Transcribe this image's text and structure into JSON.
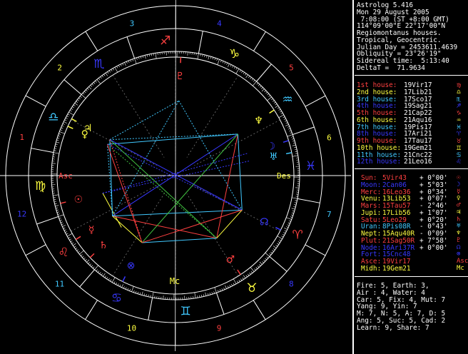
{
  "header": [
    "Astrolog 5.416",
    "Mon 29 August 2005",
    " 7:08:00 (ST +8:00 GMT)",
    "114°09'00\"E 22°17'00\"N",
    "Regiomontanus houses.",
    "Tropical, Geocentric.",
    "Julian Day = 2453611.4639",
    "Obliquity = 23°26'19\"",
    "Sidereal time:  5:13:40",
    "DeltaT =  71.9634"
  ],
  "houses": [
    {
      "label": "1st house:",
      "value": "19Vir17",
      "glyph": "♍",
      "color": "#ff4040"
    },
    {
      "label": "2nd house:",
      "value": "17Lib21",
      "glyph": "♎",
      "color": "#ffff40"
    },
    {
      "label": "3rd house:",
      "value": "17Sco17",
      "glyph": "♏",
      "color": "#40c8ff"
    },
    {
      "label": "4th house:",
      "value": "19Sag21",
      "glyph": "♐",
      "color": "#3838ff"
    },
    {
      "label": "5th house:",
      "value": "21Cap22",
      "glyph": "♑",
      "color": "#ff4040"
    },
    {
      "label": "6th house:",
      "value": "21Aqu16",
      "glyph": "♒",
      "color": "#ffff40"
    },
    {
      "label": "7th house:",
      "value": "19Pis17",
      "glyph": "♓",
      "color": "#40c8ff"
    },
    {
      "label": "8th house:",
      "value": "17Ari21",
      "glyph": "♈",
      "color": "#3838ff"
    },
    {
      "label": "9th house:",
      "value": "17Tau17",
      "glyph": "♉",
      "color": "#ff4040"
    },
    {
      "label": "10th house:",
      "value": "19Gem21",
      "glyph": "♊",
      "color": "#ffff40"
    },
    {
      "label": "11th house:",
      "value": "21Cnc22",
      "glyph": "♋",
      "color": "#40c8ff"
    },
    {
      "label": "12th house:",
      "value": "21Leo16",
      "glyph": "♌",
      "color": "#3838ff"
    }
  ],
  "planets": [
    {
      "name": "Sun:",
      "pos": "5Vir43",
      "speed": "+ 0°00'",
      "glyph": "☉",
      "color": "#ff4040"
    },
    {
      "name": "Moon:",
      "pos": "2Can06",
      "speed": "+ 5°03'",
      "glyph": "☽",
      "color": "#3838ff"
    },
    {
      "name": "Merc:",
      "pos": "16Leo36",
      "speed": "+ 0°34'",
      "glyph": "☿",
      "color": "#ff4040"
    },
    {
      "name": "Venu:",
      "pos": "13Lib53",
      "speed": "+ 0°07'",
      "glyph": "♀",
      "color": "#ffff40"
    },
    {
      "name": "Mars:",
      "pos": "15Tau57",
      "speed": "- 2°46'",
      "glyph": "♂",
      "color": "#ff4040"
    },
    {
      "name": "Jupi:",
      "pos": "17Lib56",
      "speed": "+ 1°07'",
      "glyph": "♃",
      "color": "#ffff40"
    },
    {
      "name": "Satu:",
      "pos": "5Leo29",
      "speed": "+ 0°20'",
      "glyph": "♄",
      "color": "#ff4040"
    },
    {
      "name": "Uran:",
      "pos": "8Pis08R",
      "speed": "- 0°43'",
      "glyph": "♅",
      "color": "#40c8ff"
    },
    {
      "name": "Nept:",
      "pos": "15Aqu40R",
      "speed": "- 0°09'",
      "glyph": "♆",
      "color": "#ffff40"
    },
    {
      "name": "Plut:",
      "pos": "21Sag50R",
      "speed": "+ 7°58'",
      "glyph": "♇",
      "color": "#ff4040"
    },
    {
      "name": "Node:",
      "pos": "16Ari37R",
      "speed": "+ 0°00'",
      "glyph": "☊",
      "color": "#3838ff"
    },
    {
      "name": "Fort:",
      "pos": "15Cnc48",
      "speed": "",
      "glyph": "⊗",
      "color": "#3838ff"
    },
    {
      "name": "Asce:",
      "pos": "19Vir17",
      "speed": "",
      "glyph": "Asc",
      "color": "#ff4040"
    },
    {
      "name": "Midh:",
      "pos": "19Gem21",
      "speed": "",
      "glyph": "Mc",
      "color": "#ffff40"
    }
  ],
  "summary": [
    "Fire: 5, Earth: 3,",
    "Air : 4, Water: 4",
    "Car: 5, Fix: 4, Mut: 7",
    "Yang: 9, Yin: 7",
    "M: 7, N: 5, A: 7, D: 5",
    "Ang: 5, Suc: 5, Cad: 2",
    "Learn: 9, Share: 7"
  ],
  "wheel": {
    "signs": [
      {
        "glyph": "♈",
        "color": "#ff4040"
      },
      {
        "glyph": "♉",
        "color": "#ffff40"
      },
      {
        "glyph": "♊",
        "color": "#40c8ff"
      },
      {
        "glyph": "♋",
        "color": "#3838ff"
      },
      {
        "glyph": "♌",
        "color": "#ff4040"
      },
      {
        "glyph": "♍",
        "color": "#ffff40"
      },
      {
        "glyph": "♎",
        "color": "#40c8ff"
      },
      {
        "glyph": "♏",
        "color": "#3838ff"
      },
      {
        "glyph": "♐",
        "color": "#ff4040"
      },
      {
        "glyph": "♑",
        "color": "#ffff40"
      },
      {
        "glyph": "♒",
        "color": "#40c8ff"
      },
      {
        "glyph": "♓",
        "color": "#3838ff"
      }
    ],
    "house_numbers": [
      "1",
      "2",
      "3",
      "4",
      "5",
      "6",
      "7",
      "8",
      "9",
      "10",
      "11",
      "12"
    ],
    "angle_labels": {
      "asc": "Asc",
      "des": "Des",
      "mc": "Mc"
    }
  }
}
